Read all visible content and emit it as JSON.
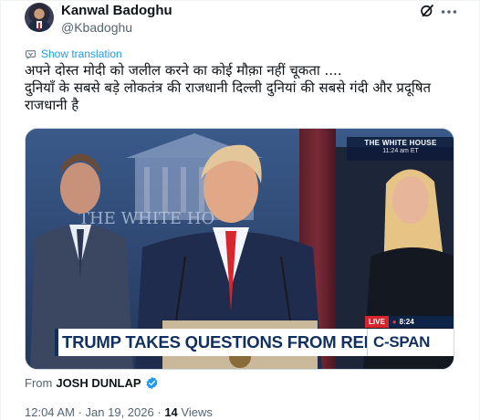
{
  "author": {
    "display_name": "Kanwal Badoghu",
    "handle": "@Kbadoghu"
  },
  "actions": {
    "grok_icon": "grok-icon",
    "more_icon": "more-icon"
  },
  "translation": {
    "label": "Show translation",
    "icon": "translate-icon"
  },
  "post": {
    "lines": [
      "अपने दोस्त मोदी को जलील करने का कोई मौक़ा नहीं चूकता ....",
      "दुनियाँ के सबसे बड़े लोकतंत्र की राजधानी दिल्ली दुनियां की सबसे गंदी और प्रदूषित",
      "राजधानी है"
    ]
  },
  "media": {
    "network_tag": "THE WHITE HOUSE",
    "network_time": "11:24 am ET",
    "backdrop_text": "THE WHITE HO",
    "live_label": "LIVE",
    "live_time": "8:24",
    "chyron": "TRUMP TAKES QUESTIONS FROM REPORTERS",
    "channel_logo": "C-SPAN"
  },
  "source": {
    "prefix": "From",
    "name": "JOSH DUNLAP",
    "verified_icon": "verified-badge-icon"
  },
  "meta": {
    "time": "12:04 AM",
    "separator": "·",
    "date": "Jan 19, 2026",
    "views_count": "14",
    "views_label": "Views"
  },
  "colors": {
    "accent": "#1d9bf0",
    "text": "#0f1419",
    "secondary": "#536471",
    "chyron_navy": "#12305f",
    "live_red": "#d8262f"
  }
}
